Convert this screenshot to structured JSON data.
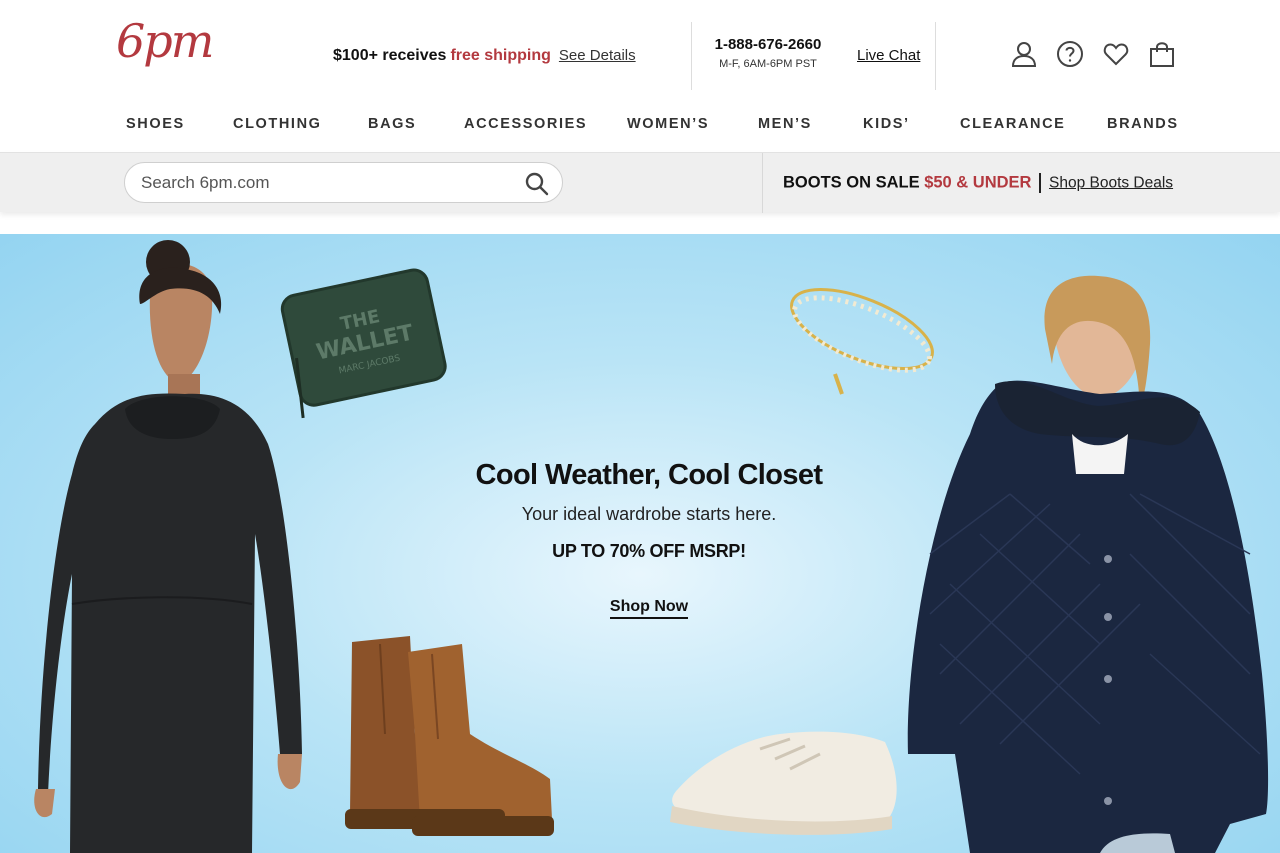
{
  "header": {
    "logo_text": "6pm",
    "shipping_text": "$100+ receives",
    "shipping_free": "free shipping",
    "shipping_details": "See Details",
    "phone": "1-888-676-2660",
    "hours": "M-F, 6AM-6PM PST",
    "live_chat": "Live Chat",
    "icons": [
      "account-icon",
      "help-icon",
      "favorites-heart-icon",
      "shopping-bag-icon"
    ]
  },
  "nav": {
    "items": [
      "SHOES",
      "CLOTHING",
      "BAGS",
      "ACCESSORIES",
      "WOMEN’S",
      "MEN’S",
      "KIDS’",
      "CLEARANCE",
      "BRANDS"
    ]
  },
  "search": {
    "placeholder": "Search 6pm.com"
  },
  "promo": {
    "part1": "BOOTS ON SALE",
    "part2": "$50 & UNDER",
    "link": "Shop Boots Deals"
  },
  "hero": {
    "heading": "Cool Weather, Cool Closet",
    "subheading": "Your ideal wardrobe starts here.",
    "offer": "UP TO 70% OFF MSRP!",
    "cta": "Shop Now",
    "wallet_text_1": "THE",
    "wallet_text_2": "WALLET",
    "wallet_brand": "MARC JACOBS"
  },
  "colors": {
    "brand": "#b3393f",
    "hero_bg": "#b9e4f6"
  }
}
